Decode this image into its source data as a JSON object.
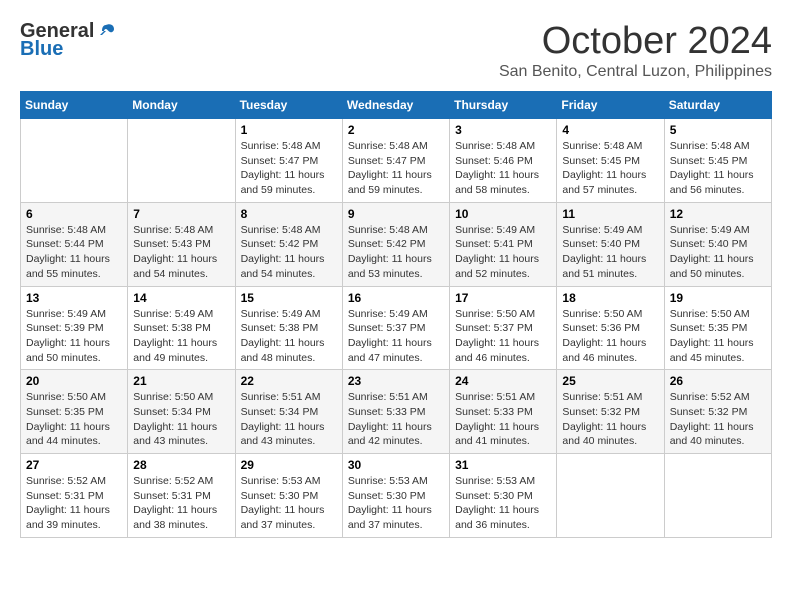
{
  "header": {
    "logo_general": "General",
    "logo_blue": "Blue",
    "month": "October 2024",
    "location": "San Benito, Central Luzon, Philippines"
  },
  "days_of_week": [
    "Sunday",
    "Monday",
    "Tuesday",
    "Wednesday",
    "Thursday",
    "Friday",
    "Saturday"
  ],
  "weeks": [
    [
      {
        "day": "",
        "info": ""
      },
      {
        "day": "",
        "info": ""
      },
      {
        "day": "1",
        "info": "Sunrise: 5:48 AM\nSunset: 5:47 PM\nDaylight: 11 hours and 59 minutes."
      },
      {
        "day": "2",
        "info": "Sunrise: 5:48 AM\nSunset: 5:47 PM\nDaylight: 11 hours and 59 minutes."
      },
      {
        "day": "3",
        "info": "Sunrise: 5:48 AM\nSunset: 5:46 PM\nDaylight: 11 hours and 58 minutes."
      },
      {
        "day": "4",
        "info": "Sunrise: 5:48 AM\nSunset: 5:45 PM\nDaylight: 11 hours and 57 minutes."
      },
      {
        "day": "5",
        "info": "Sunrise: 5:48 AM\nSunset: 5:45 PM\nDaylight: 11 hours and 56 minutes."
      }
    ],
    [
      {
        "day": "6",
        "info": "Sunrise: 5:48 AM\nSunset: 5:44 PM\nDaylight: 11 hours and 55 minutes."
      },
      {
        "day": "7",
        "info": "Sunrise: 5:48 AM\nSunset: 5:43 PM\nDaylight: 11 hours and 54 minutes."
      },
      {
        "day": "8",
        "info": "Sunrise: 5:48 AM\nSunset: 5:42 PM\nDaylight: 11 hours and 54 minutes."
      },
      {
        "day": "9",
        "info": "Sunrise: 5:48 AM\nSunset: 5:42 PM\nDaylight: 11 hours and 53 minutes."
      },
      {
        "day": "10",
        "info": "Sunrise: 5:49 AM\nSunset: 5:41 PM\nDaylight: 11 hours and 52 minutes."
      },
      {
        "day": "11",
        "info": "Sunrise: 5:49 AM\nSunset: 5:40 PM\nDaylight: 11 hours and 51 minutes."
      },
      {
        "day": "12",
        "info": "Sunrise: 5:49 AM\nSunset: 5:40 PM\nDaylight: 11 hours and 50 minutes."
      }
    ],
    [
      {
        "day": "13",
        "info": "Sunrise: 5:49 AM\nSunset: 5:39 PM\nDaylight: 11 hours and 50 minutes."
      },
      {
        "day": "14",
        "info": "Sunrise: 5:49 AM\nSunset: 5:38 PM\nDaylight: 11 hours and 49 minutes."
      },
      {
        "day": "15",
        "info": "Sunrise: 5:49 AM\nSunset: 5:38 PM\nDaylight: 11 hours and 48 minutes."
      },
      {
        "day": "16",
        "info": "Sunrise: 5:49 AM\nSunset: 5:37 PM\nDaylight: 11 hours and 47 minutes."
      },
      {
        "day": "17",
        "info": "Sunrise: 5:50 AM\nSunset: 5:37 PM\nDaylight: 11 hours and 46 minutes."
      },
      {
        "day": "18",
        "info": "Sunrise: 5:50 AM\nSunset: 5:36 PM\nDaylight: 11 hours and 46 minutes."
      },
      {
        "day": "19",
        "info": "Sunrise: 5:50 AM\nSunset: 5:35 PM\nDaylight: 11 hours and 45 minutes."
      }
    ],
    [
      {
        "day": "20",
        "info": "Sunrise: 5:50 AM\nSunset: 5:35 PM\nDaylight: 11 hours and 44 minutes."
      },
      {
        "day": "21",
        "info": "Sunrise: 5:50 AM\nSunset: 5:34 PM\nDaylight: 11 hours and 43 minutes."
      },
      {
        "day": "22",
        "info": "Sunrise: 5:51 AM\nSunset: 5:34 PM\nDaylight: 11 hours and 43 minutes."
      },
      {
        "day": "23",
        "info": "Sunrise: 5:51 AM\nSunset: 5:33 PM\nDaylight: 11 hours and 42 minutes."
      },
      {
        "day": "24",
        "info": "Sunrise: 5:51 AM\nSunset: 5:33 PM\nDaylight: 11 hours and 41 minutes."
      },
      {
        "day": "25",
        "info": "Sunrise: 5:51 AM\nSunset: 5:32 PM\nDaylight: 11 hours and 40 minutes."
      },
      {
        "day": "26",
        "info": "Sunrise: 5:52 AM\nSunset: 5:32 PM\nDaylight: 11 hours and 40 minutes."
      }
    ],
    [
      {
        "day": "27",
        "info": "Sunrise: 5:52 AM\nSunset: 5:31 PM\nDaylight: 11 hours and 39 minutes."
      },
      {
        "day": "28",
        "info": "Sunrise: 5:52 AM\nSunset: 5:31 PM\nDaylight: 11 hours and 38 minutes."
      },
      {
        "day": "29",
        "info": "Sunrise: 5:53 AM\nSunset: 5:30 PM\nDaylight: 11 hours and 37 minutes."
      },
      {
        "day": "30",
        "info": "Sunrise: 5:53 AM\nSunset: 5:30 PM\nDaylight: 11 hours and 37 minutes."
      },
      {
        "day": "31",
        "info": "Sunrise: 5:53 AM\nSunset: 5:30 PM\nDaylight: 11 hours and 36 minutes."
      },
      {
        "day": "",
        "info": ""
      },
      {
        "day": "",
        "info": ""
      }
    ]
  ]
}
